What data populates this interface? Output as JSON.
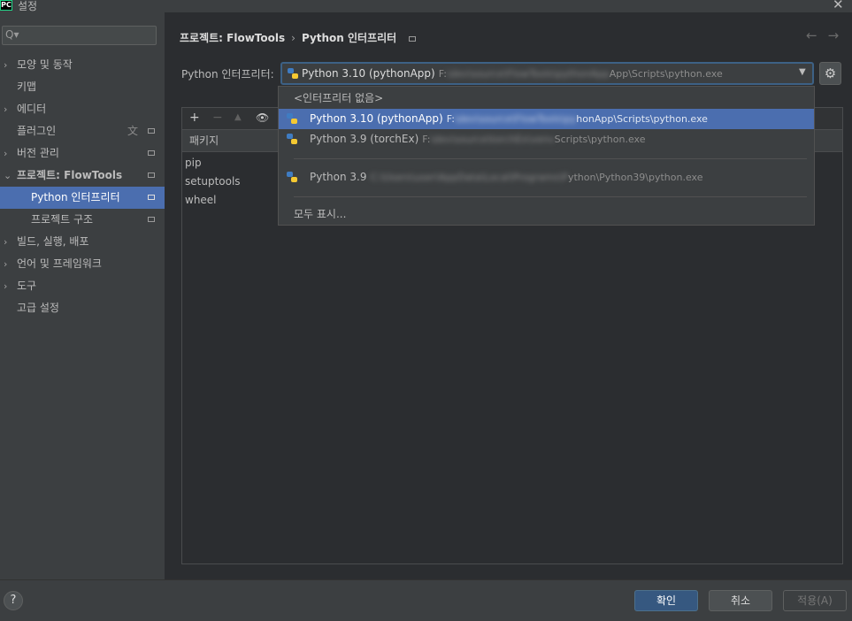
{
  "window": {
    "title": "설정",
    "app_icon_text": "PC",
    "close_icon": "close-icon"
  },
  "sidebar": {
    "search_placeholder": "Q▾",
    "items": [
      {
        "label": "모양 및 동작",
        "expandable": true
      },
      {
        "label": "키맵",
        "expandable": false
      },
      {
        "label": "에디터",
        "expandable": true
      },
      {
        "label": "플러그인",
        "expandable": false
      },
      {
        "label": "버전 관리",
        "expandable": true
      },
      {
        "label": "프로젝트: FlowTools",
        "expandable": true,
        "expanded": true
      },
      {
        "label": "Python 인터프리터",
        "selected": true
      },
      {
        "label": "프로젝트 구조"
      },
      {
        "label": "빌드, 실행, 배포",
        "expandable": true
      },
      {
        "label": "언어 및 프레임워크",
        "expandable": true
      },
      {
        "label": "도구",
        "expandable": true
      },
      {
        "label": "고급 설정",
        "expandable": false
      }
    ]
  },
  "breadcrumb": {
    "project": "프로젝트: FlowTools",
    "sep": "›",
    "page": "Python 인터프리터"
  },
  "interpreter": {
    "label": "Python 인터프리터:",
    "selected": "Python 3.10 (pythonApp)",
    "path_prefix": "F:",
    "path_blur": "\\dev\\source\\FlowTools\\pythonApp",
    "path_suffix": "App\\Scripts\\python.exe"
  },
  "packages": {
    "toolbar": [
      "+",
      "−",
      "▲",
      "👁"
    ],
    "column_header": "패키지",
    "rows": [
      "pip",
      "setuptools",
      "wheel"
    ]
  },
  "dropdown": {
    "no_interpreter": "<인터프리터 없음>",
    "options": [
      {
        "name": "Python 3.10 (pythonApp)",
        "path_prefix": "F:",
        "path_blur": "\\dev\\source\\FlowTools\\py",
        "path_suffix": "honApp\\Scripts\\python.exe"
      },
      {
        "name": "Python 3.9 (torchEx)",
        "path_prefix": "F:",
        "path_blur": "\\dev\\source\\torchEx\\venv",
        "path_suffix": "Scripts\\python.exe"
      },
      {
        "name": "Python 3.9",
        "path_prefix": "",
        "path_blur": "C:\\Users\\user\\AppData\\Local\\Programs\\P",
        "path_suffix": "ython\\Python39\\python.exe"
      }
    ],
    "show_all": "모두 표시..."
  },
  "footer": {
    "help": "?",
    "ok": "확인",
    "cancel": "취소",
    "apply": "적용(A)"
  },
  "colors": {
    "accent": "#4b6eaf",
    "background": "#2b2d30",
    "panel": "#3c3f41"
  }
}
